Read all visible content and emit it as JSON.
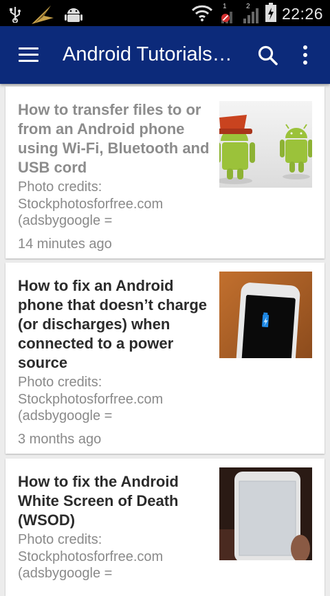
{
  "status_bar": {
    "time": "22:26",
    "sim1_label": "1",
    "sim2_label": "2",
    "icons": [
      "usb-icon",
      "star-trek-icon",
      "android-debug-icon",
      "wifi-icon",
      "signal-sim1-icon",
      "signal-sim2-icon",
      "battery-charging-icon"
    ]
  },
  "app_bar": {
    "title": "Android Tutorials…",
    "icons": [
      "menu-icon",
      "search-icon",
      "overflow-icon"
    ],
    "color": "#0c2a7a"
  },
  "articles": [
    {
      "title": "How to transfer files to or from an Android phone using Wi-Fi, Bluetooth and USB cord",
      "description": "Photo credits: Stockphotosforfree.com (adsbygoogle =",
      "time": "14 minutes ago",
      "visited": true,
      "thumbnail": "two-android-figures-image"
    },
    {
      "title": "How to fix an Android phone that doesn’t charge (or discharges) when connected to a power source",
      "description": "Photo credits: Stockphotosforfree.com (adsbygoogle =",
      "time": "3 months ago",
      "visited": false,
      "thumbnail": "phone-charging-image"
    },
    {
      "title": "How to fix the Android White Screen of Death (WSOD)",
      "description": "Photo credits: Stockphotosforfree.com (adsbygoogle =",
      "time": "",
      "visited": false,
      "thumbnail": "white-screen-phone-image"
    }
  ]
}
